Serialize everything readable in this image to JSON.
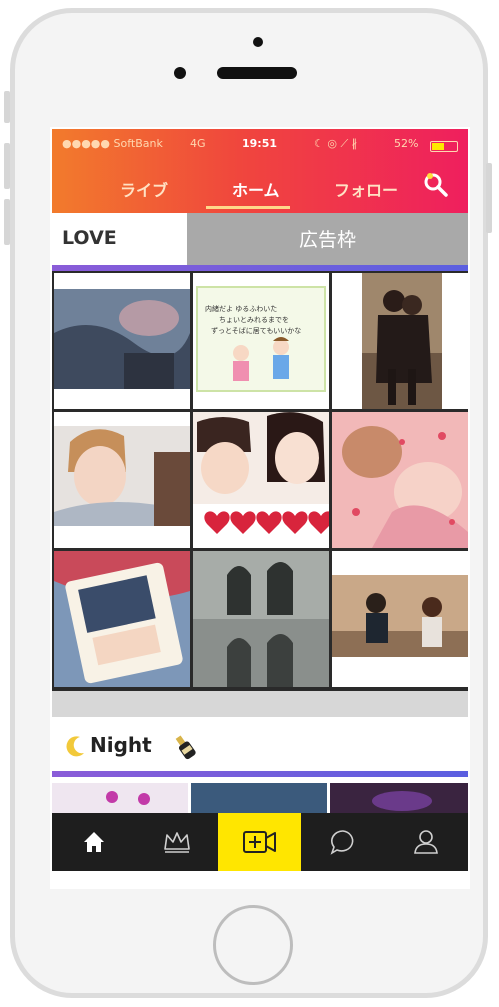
{
  "status_bar": {
    "carrier": "●●●●● SoftBank",
    "network": "4G",
    "time": "19:51",
    "icons": "☾ ◎ ⟋ ∦",
    "battery_percent": "52%",
    "battery_level": 0.52
  },
  "top_nav": {
    "tabs": [
      {
        "label": "ライブ"
      },
      {
        "label": "ホーム"
      },
      {
        "label": "フォロー"
      }
    ],
    "active_tab": "ホーム"
  },
  "sections": {
    "love": {
      "title": "LOVE"
    },
    "ad": {
      "label": "広告枠"
    },
    "night": {
      "title": "Night"
    }
  },
  "grid": {
    "tiles": [
      {
        "caption": "",
        "handwriting_lines": []
      },
      {
        "caption": "",
        "handwriting_lines": [
          "内緒だよ ゆるふわいた",
          "ちょいとみれるまでを",
          "ずっとそばに居てもいいかな"
        ]
      },
      {
        "caption": "",
        "handwriting_lines": []
      },
      {
        "caption": "",
        "handwriting_lines": []
      },
      {
        "caption": "",
        "handwriting_lines": []
      },
      {
        "caption": "",
        "handwriting_lines": []
      },
      {
        "caption": "",
        "handwriting_lines": []
      },
      {
        "caption": "",
        "handwriting_lines": []
      },
      {
        "caption": "",
        "handwriting_lines": []
      }
    ]
  },
  "bottom_tabs": [
    {
      "icon": "home-icon"
    },
    {
      "icon": "crown-icon"
    },
    {
      "icon": "add-video-icon"
    },
    {
      "icon": "chat-bubble-icon"
    },
    {
      "icon": "profile-icon"
    }
  ],
  "colors": {
    "header_gradient_start": "#f27b2c",
    "header_gradient_end": "#ef1f5e",
    "ad_background": "#a9a9a9",
    "active_tab_background": "#ffe600",
    "tab_bar_background": "#1e1e1e",
    "divider": "#6a5ce0"
  }
}
